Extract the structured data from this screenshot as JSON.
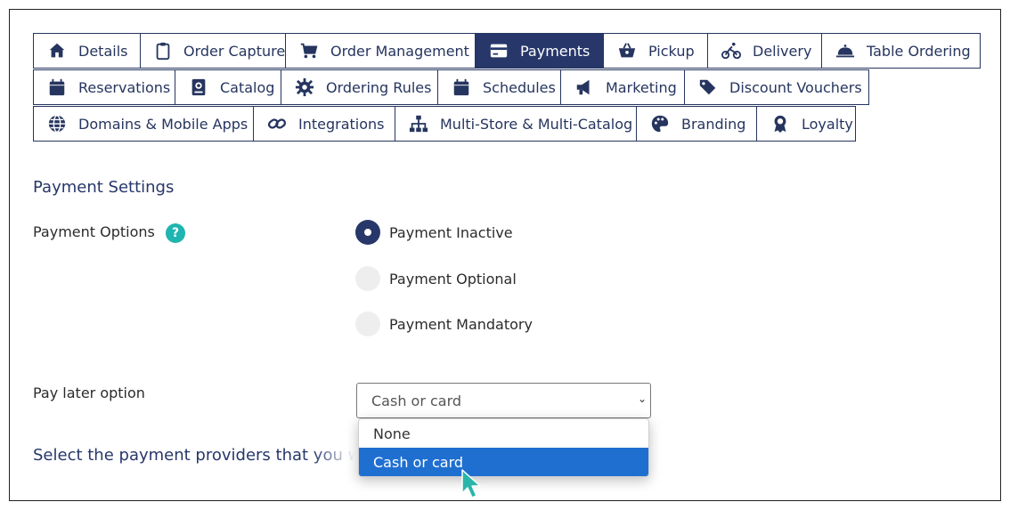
{
  "tabs": [
    {
      "label": "Details",
      "icon": "home-icon"
    },
    {
      "label": "Order Capture",
      "icon": "clipboard-icon"
    },
    {
      "label": "Order Management",
      "icon": "cart-icon"
    },
    {
      "label": "Payments",
      "icon": "credit-card-icon",
      "active": true
    },
    {
      "label": "Pickup",
      "icon": "basket-icon"
    },
    {
      "label": "Delivery",
      "icon": "bicycle-icon"
    },
    {
      "label": "Table Ordering",
      "icon": "cloche-icon"
    },
    {
      "label": "Reservations",
      "icon": "calendar-icon"
    },
    {
      "label": "Catalog",
      "icon": "book-icon"
    },
    {
      "label": "Ordering Rules",
      "icon": "gear-icon"
    },
    {
      "label": "Schedules",
      "icon": "calendar-icon"
    },
    {
      "label": "Marketing",
      "icon": "megaphone-icon"
    },
    {
      "label": "Discount Vouchers",
      "icon": "tags-icon"
    },
    {
      "label": "Domains & Mobile Apps",
      "icon": "globe-icon"
    },
    {
      "label": "Integrations",
      "icon": "link-icon"
    },
    {
      "label": "Multi-Store & Multi-Catalog",
      "icon": "sitemap-icon"
    },
    {
      "label": "Branding",
      "icon": "palette-icon"
    },
    {
      "label": "Loyalty",
      "icon": "award-icon"
    }
  ],
  "payment_settings": {
    "title": "Payment Settings",
    "payment_options_label": "Payment Options",
    "help_glyph": "?",
    "options": [
      "Payment Inactive",
      "Payment Optional",
      "Payment Mandatory"
    ],
    "selected_option": "Payment Inactive",
    "pay_later_label": "Pay later option",
    "pay_later_value": "Cash or card",
    "pay_later_options": [
      "None",
      "Cash or card"
    ],
    "pay_later_highlighted": "Cash or card",
    "providers_title": "Select the payment providers that you war"
  },
  "colors": {
    "navy": "#27376a",
    "teal": "#1fb5b0",
    "highlight": "#1f6fd1",
    "cursor": "#2ab5a9"
  }
}
